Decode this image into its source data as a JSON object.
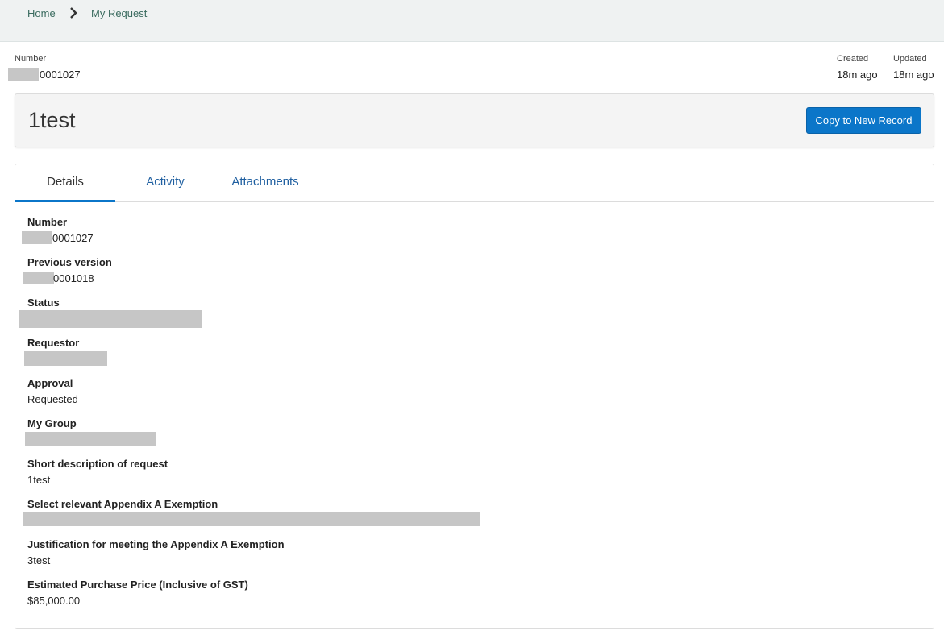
{
  "breadcrumb": {
    "home": "Home",
    "current": "My Request"
  },
  "header": {
    "number_label": "Number",
    "number_value": "0001027",
    "created_label": "Created",
    "created_value": "18m ago",
    "updated_label": "Updated",
    "updated_value": "18m ago"
  },
  "record": {
    "title": "1test",
    "copy_button": "Copy to New Record"
  },
  "tabs": [
    {
      "label": "Details"
    },
    {
      "label": "Activity"
    },
    {
      "label": "Attachments"
    }
  ],
  "fields": [
    {
      "label": "Number",
      "value": "0001027"
    },
    {
      "label": "Previous version",
      "value": "0001018"
    },
    {
      "label": "Status",
      "value": ""
    },
    {
      "label": "Requestor",
      "value": ""
    },
    {
      "label": "Approval",
      "value": "Requested"
    },
    {
      "label": "My Group",
      "value": ""
    },
    {
      "label": "Short description of request",
      "value": "1test"
    },
    {
      "label": "Select relevant Appendix A Exemption",
      "value": ""
    },
    {
      "label": "Justification for meeting the Appendix A Exemption",
      "value": "3test"
    },
    {
      "label": "Estimated Purchase Price (Inclusive of GST)",
      "value": "$85,000.00"
    }
  ],
  "colors": {
    "accent": "#0b76c9",
    "link": "#1f5fa0",
    "breadcrumb": "#3a6b5f",
    "redaction": "#c6c6c6"
  },
  "icons": {
    "breadcrumb_separator": "chevron-right-icon"
  }
}
